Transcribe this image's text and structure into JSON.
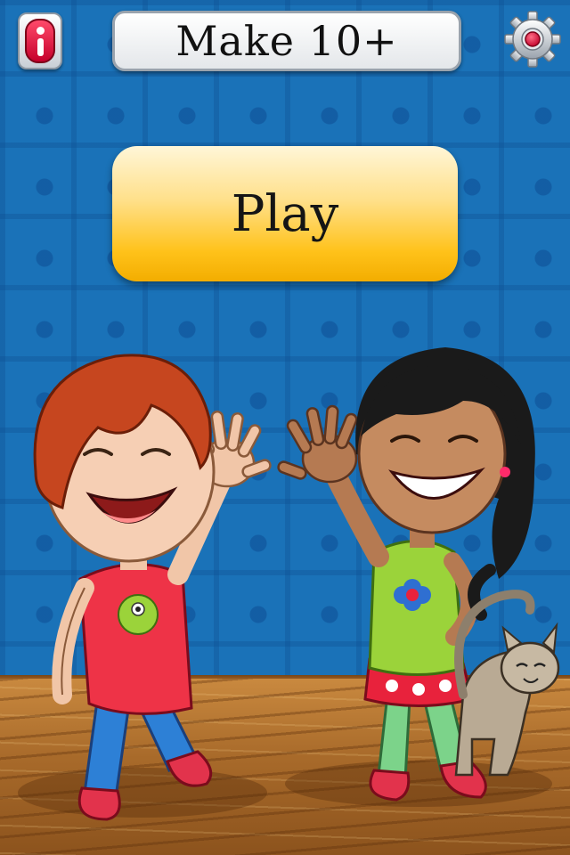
{
  "header": {
    "title": "Make 10+"
  },
  "main": {
    "play_label": "Play"
  },
  "icons": {
    "info": "info-icon",
    "settings": "gear-icon"
  },
  "colors": {
    "background": "#2083cb",
    "play_button": "#ffc21a",
    "info_button": "#e0173f",
    "floor": "#b0712f"
  }
}
